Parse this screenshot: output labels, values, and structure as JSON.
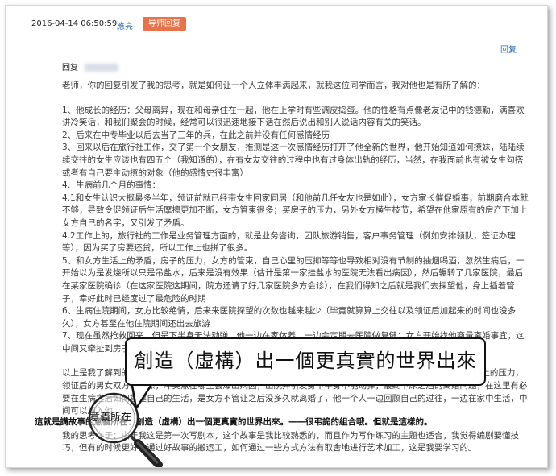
{
  "post": {
    "date": "2016-04-14 06:50:59",
    "author": "應亮",
    "badge": "导师回复",
    "reply_action": "回复",
    "reply_to_label": "回复"
  },
  "body": {
    "intro": "老师，你的回复引发了我的思考，就是如何让一个人立体丰满起来，就我这位同学而言，我对他也是有所了解的：",
    "items": [
      "1、他成长的经历：父母离异，现在和母亲住在一起，他在上学时有些调皮捣蛋。他的性格有点像老友记中的钱德勒，满喜欢讲冷笑话，和我们聚会的时候，经常可以很迅速地接下话在然后说出和别人说话内容有关的笑话。",
      "2、后来在中专毕业以后去当了三年的兵，在此之前并没有任何感情经历",
      "3、回来以后在旅行社工作，交了第一个女朋友，推测是这一次感情经历打开了他全新的世界，他开始知道如何撩妹，陆陆续续交往的女生应该也有四五个（我知道的），在有女友交往的过程中也有过身体出轨的经历，当然，在我面前也有被女生勾搭或者有自己要主动撩的对象（他的感情史很丰富）",
      "4、生病前几个月的事情：",
      "4.1和女生认识大概最多半年，领证前就已经带女生回家同居（和他前几任女友也是如此），女方家长催促婚事，前期磨合本就不够，导致令促领证后生活摩擦更加不断，女方管束很多；买房子的压力，另外女方横生枝节，希望在他家原有的房产下加上女方自己的名字，又引发了矛盾。",
      "4.2工作上的，旅行社的工作是业务管理方面的，就是业务咨询，团队旅游销售，客户事务管理（例如安排领队，签证办理等），因为买了房要还贷，所以工作上也拼了很多。",
      "5、和女方生活上的矛盾，房子的压力，女方的管束，自己心里的压抑等等也导致相对没有节制的抽烟喝酒，忽然生病后，一开始以为是发烧所以只是吊盐水，后来是没有效果（估计是第一家挂盐水的医院无法看出病因），然后辗转了几家医院，最后在某家医院确诊（在这家医院这期间，院方还请了好几家医院多方会诊），在我们得知之后就是我们去探望他，身上插着管子，幸好此时已经度过了最危险的时期",
      "6、生病住院期间，女方比较绝情，后来来医院探望的次数也越来越少（毕竟就算算上交往以及领证后加起来的时间也没多久），女方甚至在他住院期间还出去旅游",
      "7、现在虽然抢救回来，但是下半身无法动弹，他一边在家休养，一边会定期去医院做复健；女方开始找他商量离婚事宜，这中间又牵扯到房子的问题（两个人一起还贷的），但是他不着急。"
    ],
    "conclusion_a": "以上是我了解到的，老师您说的“被动中的主动”我觉得是否可以通过他“负气决定结婚领证，众鼠决定买房，工作上的压力，领证后的男女双方的摩擦，冲突点在哪里会爆出病因，出院并引发身下半身不能动弹，最终下床之后的离婚问题，在这里有必要在生病之后如何重建自己的生活，是女方不管让",
    "conclusion_a2": "之后没多久就离婚了，他一个人一边回顾自己的过往，一边在家中生活，中间可以加入他",
    "conclusion_b": "我的思考在于：由于我这是第一次写剧本，这个故事是我比较熟悉的，而且作为写作练习的主题也适合，我觉得编剧要懂技巧，但有的时候更好地通过好故事的搬运工，如何通过一些方式方法有取舍地进行艺术加工，这是我要学习的。"
  },
  "caption": "這就是講故事的意義所在：創造（虛構）出一個更真實的世界出來。——很弔詭的組合哦。但就是這樣的。",
  "bubble": {
    "text": "創造（虛構）出一個更真實的世界出來"
  },
  "magnifier": {
    "text": "意義所在"
  }
}
